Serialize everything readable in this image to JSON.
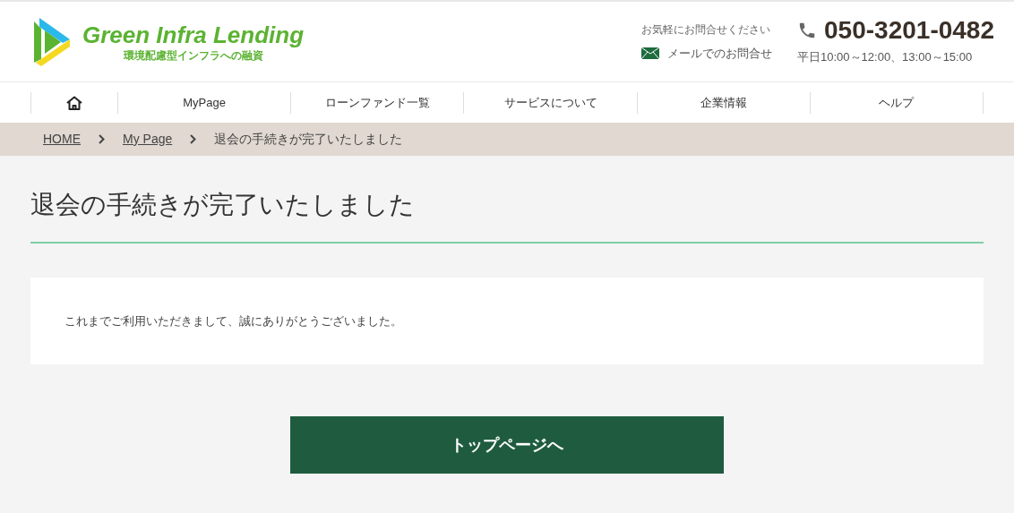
{
  "header": {
    "logo": {
      "name": "Green Infra Lending",
      "tagline": "環境配慮型インフラへの融資"
    },
    "contact_prompt": "お気軽にお問合せください",
    "mail_link": "メールでのお問合せ",
    "phone": "050-3201-0482",
    "hours": "平日10:00～12:00、13:00～15:00"
  },
  "nav": [
    {
      "kind": "home"
    },
    {
      "kind": "text",
      "label": "MyPage"
    },
    {
      "kind": "text",
      "label": "ローンファンド一覧"
    },
    {
      "kind": "text",
      "label": "サービスについて"
    },
    {
      "kind": "text",
      "label": "企業情報"
    },
    {
      "kind": "text",
      "label": "ヘルプ"
    }
  ],
  "breadcrumb": [
    {
      "label": "HOME",
      "link": true
    },
    {
      "label": "My Page",
      "link": true
    },
    {
      "label": "退会の手続きが完了いたしました",
      "link": false
    }
  ],
  "page_title": "退会の手続きが完了いたしました",
  "message": "これまでご利用いただきまして、誠にありがとうございました。",
  "top_button": "トップページへ"
}
